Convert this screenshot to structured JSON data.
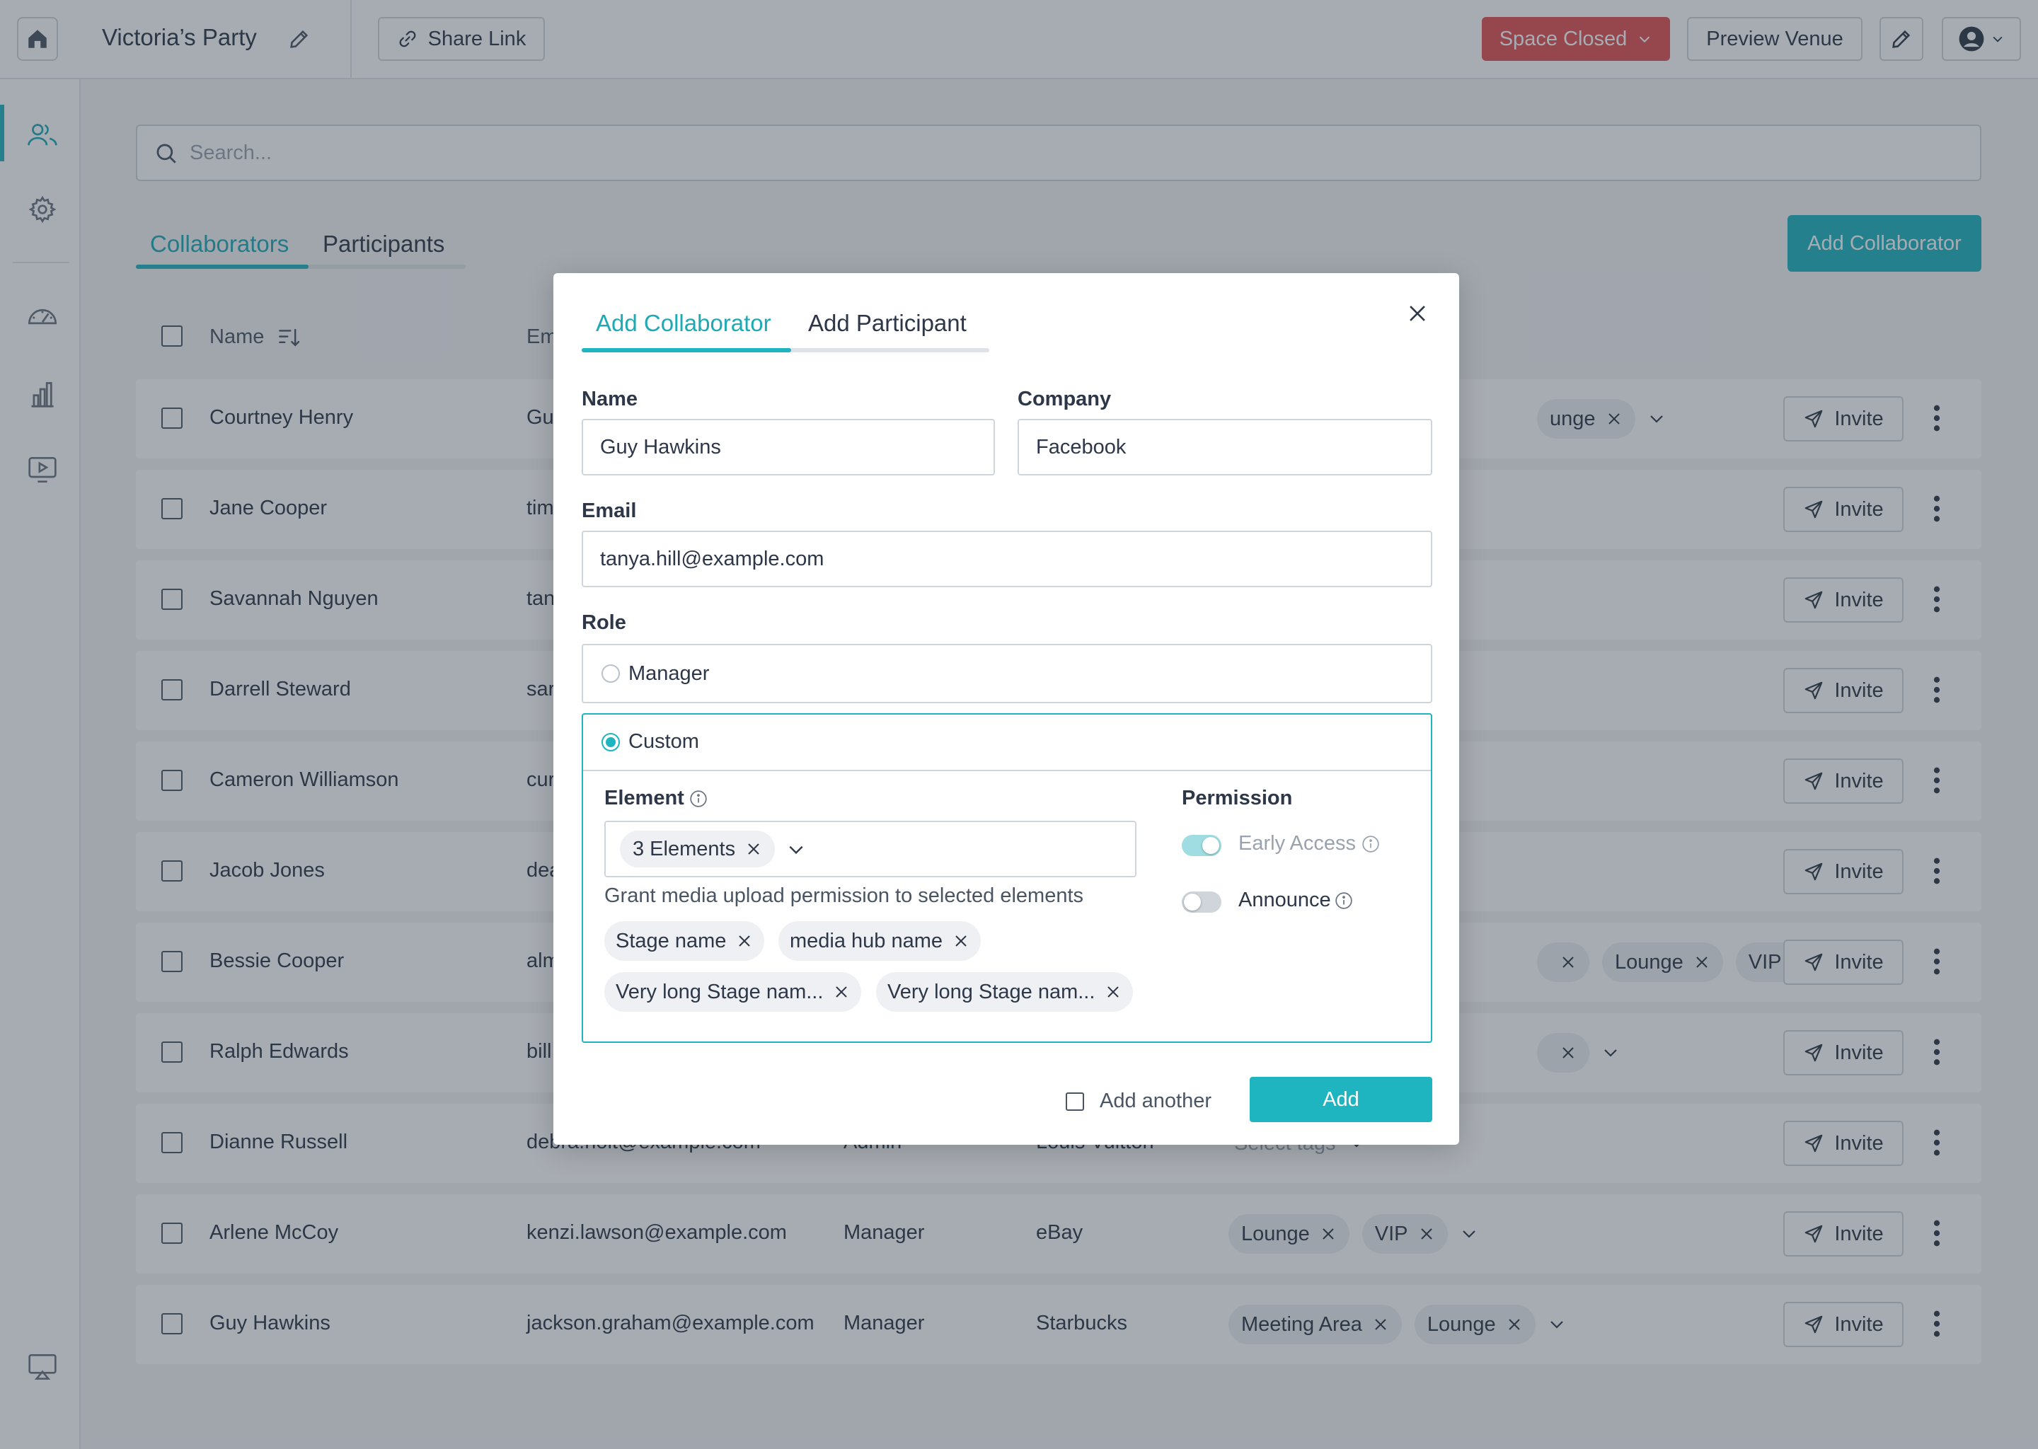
{
  "topbar": {
    "space_title": "Victoria’s Party",
    "share_label": "Share Link",
    "status_label": "Space Closed",
    "preview_label": "Preview Venue"
  },
  "search": {
    "placeholder": "Search..."
  },
  "main_tabs": [
    "Collaborators",
    "Participants"
  ],
  "add_collaborator_label": "Add Collaborator",
  "table": {
    "col_name": "Name",
    "col_email": "Em",
    "invite_label": "Invite",
    "rows": [
      {
        "name": "Courtney Henry",
        "email": "Gu",
        "role": "",
        "company": "",
        "tags": [
          "unge"
        ],
        "select_tags": ""
      },
      {
        "name": "Jane Cooper",
        "email": "tim",
        "role": "",
        "company": "",
        "tags": [],
        "select_tags": ""
      },
      {
        "name": "Savannah Nguyen",
        "email": "tan",
        "role": "",
        "company": "",
        "tags": [],
        "select_tags": ""
      },
      {
        "name": "Darrell Steward",
        "email": "sar",
        "role": "",
        "company": "",
        "tags": [],
        "select_tags": ""
      },
      {
        "name": "Cameron Williamson",
        "email": "cur",
        "role": "",
        "company": "",
        "tags": [],
        "select_tags": ""
      },
      {
        "name": "Jacob Jones",
        "email": "dea",
        "role": "",
        "company": "",
        "tags": [],
        "select_tags": ""
      },
      {
        "name": "Bessie Cooper",
        "email": "alm",
        "role": "",
        "company": "",
        "tags": [
          "",
          "Lounge",
          "VIP"
        ],
        "select_tags": ""
      },
      {
        "name": "Ralph Edwards",
        "email": "bill",
        "role": "",
        "company": "",
        "tags": [
          ""
        ],
        "select_tags": ""
      },
      {
        "name": "Dianne Russell",
        "email": "debra.holt@example.com",
        "role": "Admin",
        "company": "Louis Vuitton",
        "tags": [],
        "select_tags": "Select tags"
      },
      {
        "name": "Arlene McCoy",
        "email": "kenzi.lawson@example.com",
        "role": "Manager",
        "company": "eBay",
        "tags": [
          "Lounge",
          "VIP"
        ],
        "select_tags": ""
      },
      {
        "name": "Guy Hawkins",
        "email": "jackson.graham@example.com",
        "role": "Manager",
        "company": "Starbucks",
        "tags": [
          "Meeting Area",
          "Lounge"
        ],
        "select_tags": ""
      }
    ]
  },
  "modal": {
    "tabs": [
      "Add Collaborator",
      "Add Participant"
    ],
    "name_label": "Name",
    "name_value": "Guy Hawkins",
    "company_label": "Company",
    "company_value": "Facebook",
    "email_label": "Email",
    "email_value": "tanya.hill@example.com",
    "role_label": "Role",
    "role_options": [
      "Manager",
      "Custom"
    ],
    "selected_role": "Custom",
    "element_label": "Element",
    "element_summary": "3 Elements",
    "element_hint": "Grant media upload permission to selected elements",
    "selected_elements": [
      "Stage name",
      "media hub name",
      "Very long Stage nam...",
      "Very long Stage nam..."
    ],
    "permission_label": "Permission",
    "permissions": [
      {
        "label": "Early Access",
        "enabled": true
      },
      {
        "label": "Announce",
        "enabled": false
      }
    ],
    "add_another_label": "Add another",
    "add_label": "Add"
  },
  "colors": {
    "accent": "#1eb4c0",
    "danger": "#e05252",
    "text": "#2d3748"
  }
}
